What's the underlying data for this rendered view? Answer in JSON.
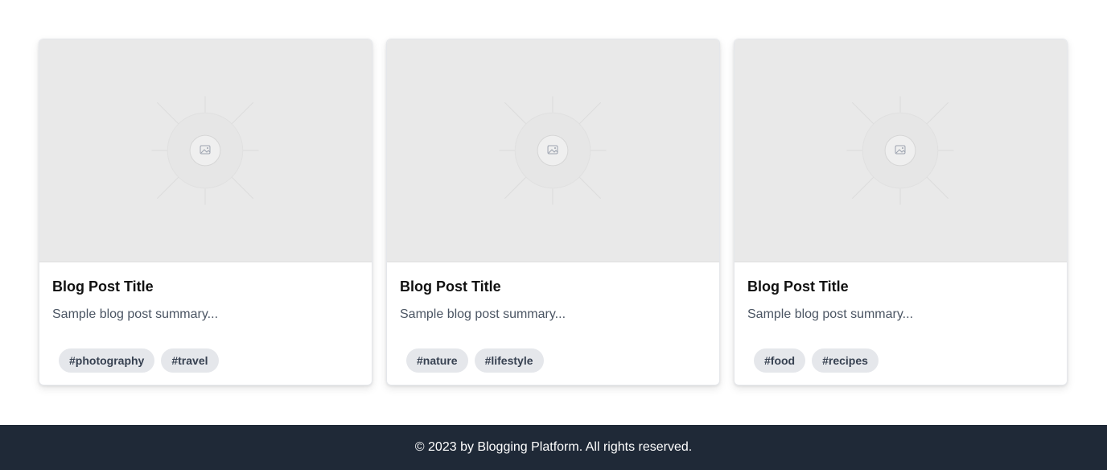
{
  "posts": [
    {
      "title": "Blog Post Title",
      "summary": "Sample blog post summary...",
      "image_icon": "image-placeholder-icon",
      "tags": [
        "#photography",
        "#travel"
      ]
    },
    {
      "title": "Blog Post Title",
      "summary": "Sample blog post summary...",
      "image_icon": "image-placeholder-icon",
      "tags": [
        "#nature",
        "#lifestyle"
      ]
    },
    {
      "title": "Blog Post Title",
      "summary": "Sample blog post summary...",
      "image_icon": "image-placeholder-icon",
      "tags": [
        "#food",
        "#recipes"
      ]
    }
  ],
  "footer": {
    "text": "© 2023 by Blogging Platform. All rights reserved."
  },
  "colors": {
    "footer_bg": "#1f2937",
    "tag_bg": "#e5e7eb",
    "placeholder_bg": "#e9e9e9"
  }
}
